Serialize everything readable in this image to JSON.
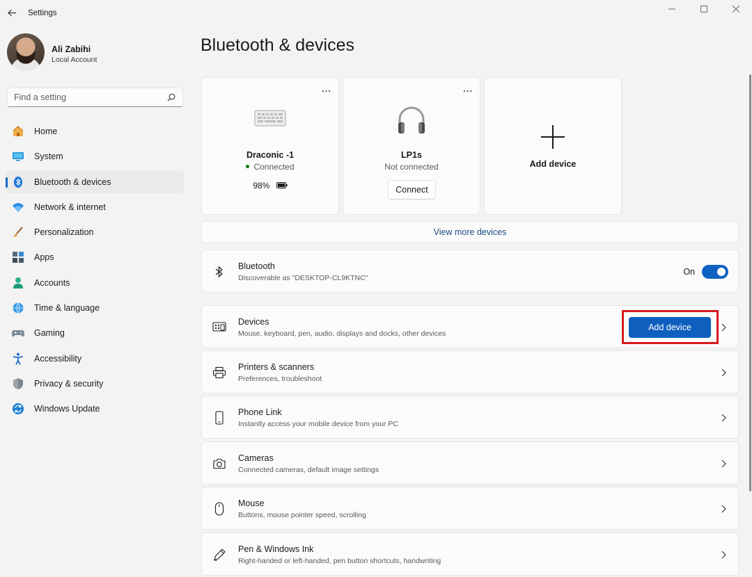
{
  "window": {
    "title": "Settings"
  },
  "profile": {
    "name": "Ali Zabihi",
    "account_type": "Local Account"
  },
  "search": {
    "placeholder": "Find a setting"
  },
  "nav": {
    "items": [
      {
        "label": "Home",
        "icon": "home-icon"
      },
      {
        "label": "System",
        "icon": "system-icon"
      },
      {
        "label": "Bluetooth & devices",
        "icon": "bluetooth-icon",
        "active": true
      },
      {
        "label": "Network & internet",
        "icon": "wifi-icon"
      },
      {
        "label": "Personalization",
        "icon": "brush-icon"
      },
      {
        "label": "Apps",
        "icon": "apps-icon"
      },
      {
        "label": "Accounts",
        "icon": "accounts-icon"
      },
      {
        "label": "Time & language",
        "icon": "globe-icon"
      },
      {
        "label": "Gaming",
        "icon": "gamepad-icon"
      },
      {
        "label": "Accessibility",
        "icon": "accessibility-icon"
      },
      {
        "label": "Privacy & security",
        "icon": "shield-icon"
      },
      {
        "label": "Windows Update",
        "icon": "update-icon"
      }
    ]
  },
  "main": {
    "title": "Bluetooth & devices",
    "cards": {
      "device1": {
        "name": "Draconic -1",
        "status": "Connected",
        "battery": "98%",
        "more": "..."
      },
      "device2": {
        "name": "LP1s",
        "status": "Not connected",
        "connect_label": "Connect",
        "more": "..."
      },
      "add": {
        "label": "Add device"
      }
    },
    "view_more": "View more devices",
    "bluetooth": {
      "title": "Bluetooth",
      "subtitle": "Discoverable as \"DESKTOP-CL9KTNC\"",
      "toggle_label": "On"
    },
    "rows": {
      "devices": {
        "title": "Devices",
        "subtitle": "Mouse, keyboard, pen, audio, displays and docks, other devices",
        "button": "Add device"
      },
      "printers": {
        "title": "Printers & scanners",
        "subtitle": "Preferences, troubleshoot"
      },
      "phone": {
        "title": "Phone Link",
        "subtitle": "Instantly access your mobile device from your PC"
      },
      "cameras": {
        "title": "Cameras",
        "subtitle": "Connected cameras, default image settings"
      },
      "mouse": {
        "title": "Mouse",
        "subtitle": "Buttons, mouse pointer speed, scrolling"
      },
      "pen": {
        "title": "Pen & Windows Ink",
        "subtitle": "Right-handed or left-handed, pen button shortcuts, handwriting"
      }
    }
  },
  "colors": {
    "accent": "#0f5fbf",
    "highlight": "#d71920",
    "background": "#f3f3f3"
  }
}
